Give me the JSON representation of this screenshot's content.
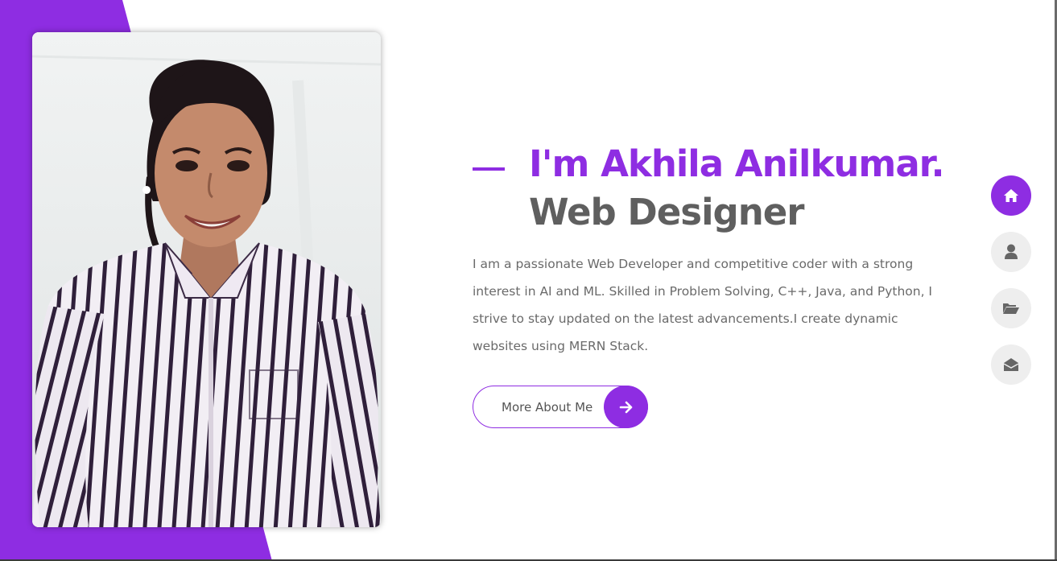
{
  "hero": {
    "name": "I'm Akhila Anilkumar.",
    "role": "Web Designer",
    "bio": "I am a passionate Web Developer and competitive coder with a strong interest in AI and ML. Skilled in Problem Solving, C++, Java, and Python, I strive to stay updated on the latest advancements.I create dynamic websites using MERN Stack."
  },
  "cta": {
    "label": "More About Me",
    "icon": "arrow-right-icon"
  },
  "nav": {
    "items": [
      {
        "icon": "home-icon",
        "active": true
      },
      {
        "icon": "user-icon",
        "active": false
      },
      {
        "icon": "folder-open-icon",
        "active": false
      },
      {
        "icon": "envelope-open-icon",
        "active": false
      }
    ]
  },
  "colors": {
    "accent": "#8e2de2",
    "heading_gray": "#5f5f5f",
    "body_text": "#6a6a6a",
    "nav_inactive_bg": "#eeeeee"
  }
}
